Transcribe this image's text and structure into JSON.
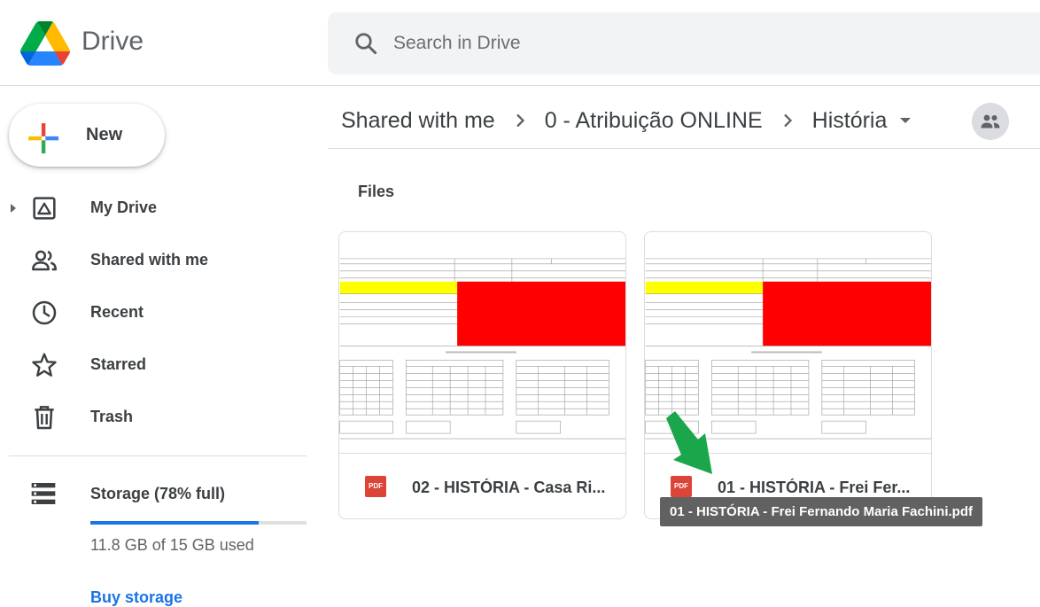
{
  "app": {
    "brand": "Drive"
  },
  "search": {
    "placeholder": "Search in Drive"
  },
  "sidebar": {
    "new_label": "New",
    "items": [
      {
        "label": "My Drive",
        "icon": "my-drive-icon"
      },
      {
        "label": "Shared with me",
        "icon": "people-icon"
      },
      {
        "label": "Recent",
        "icon": "clock-icon"
      },
      {
        "label": "Starred",
        "icon": "star-icon"
      },
      {
        "label": "Trash",
        "icon": "trash-icon"
      }
    ],
    "storage": {
      "label": "Storage (78% full)",
      "percent_used": 78,
      "used_text": "11.8 GB of 15 GB used",
      "buy_label": "Buy storage"
    }
  },
  "breadcrumb": {
    "items": [
      "Shared with me",
      "0 - Atribuição ONLINE",
      "História"
    ]
  },
  "main": {
    "files_heading": "Files",
    "files": [
      {
        "name": "02 - HISTÓRIA - Casa Ri...",
        "type_badge": "PDF"
      },
      {
        "name": "01 - HISTÓRIA - Frei Fer...",
        "type_badge": "PDF"
      }
    ]
  },
  "tooltip": {
    "text": "01 - HISTÓRIA - Frei Fernando Maria Fachini.pdf"
  },
  "colors": {
    "accent": "#1a73e8",
    "pdf_red": "#db4437",
    "highlight_yellow": "#ffff00",
    "block_red": "#ff0000",
    "pointer_green": "#1aa64a"
  }
}
